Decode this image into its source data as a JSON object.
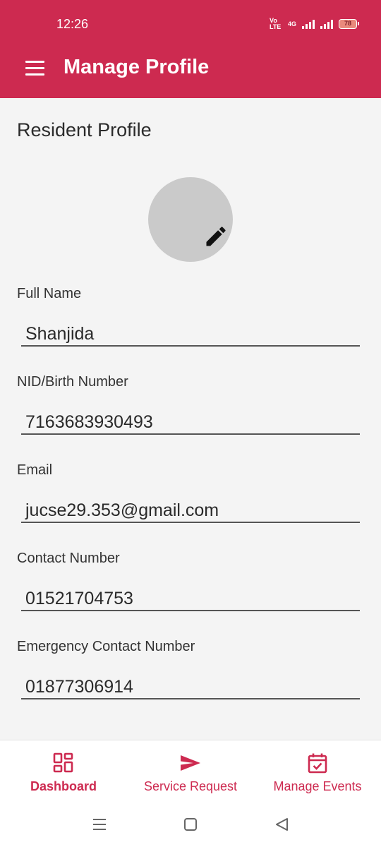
{
  "status_bar": {
    "time": "12:26",
    "volte": "Vo LTE",
    "network": "4G",
    "battery": "78"
  },
  "app_bar": {
    "title": "Manage Profile",
    "menu_icon": "hamburger-menu-icon",
    "color": "#cd2a50"
  },
  "profile": {
    "section_title": "Resident Profile",
    "avatar_edit_icon": "pencil-edit-icon",
    "fields": [
      {
        "label": "Full Name",
        "value": "Shanjida"
      },
      {
        "label": "NID/Birth Number",
        "value": "7163683930493"
      },
      {
        "label": "Email",
        "value": "jucse29.353@gmail.com"
      },
      {
        "label": "Contact Number",
        "value": "01521704753"
      },
      {
        "label": "Emergency Contact Number",
        "value": "01877306914"
      }
    ]
  },
  "bottom_nav": {
    "active": "Dashboard",
    "items": [
      {
        "label": "Dashboard",
        "icon": "dashboard-grid-icon"
      },
      {
        "label": "Service Request",
        "icon": "send-icon"
      },
      {
        "label": "Manage Events",
        "icon": "calendar-check-icon"
      }
    ]
  },
  "system_nav": {
    "icons": [
      "recents-icon",
      "home-icon",
      "back-icon"
    ]
  }
}
